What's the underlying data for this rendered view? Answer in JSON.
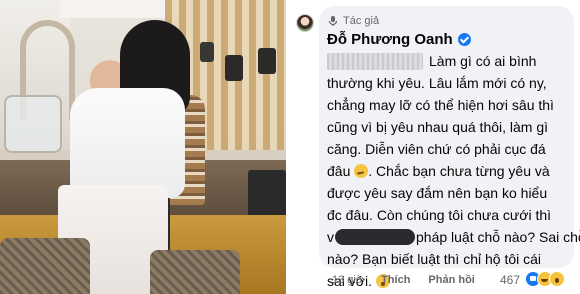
{
  "post": {
    "author_badge": "Tác giả",
    "author_name": "Đỗ Phương Oanh",
    "verified_icon": "verified-badge-icon",
    "comment_lines": [
      "Làm gì có ai bình",
      "thường khi yêu. Lâu lắm mới có ny,",
      "chẳng may lỡ có thể hiện hơi sâu thì",
      "cũng vì bị yêu nhau quá thôi, làm gì",
      "căng. Diễn viên chứ có phải cục đá",
      "đâu",
      ". Chắc bạn chưa từng yêu và",
      "được yêu say đắm nên bạn ko hiểu",
      "đc đâu. Còn chúng tôi chưa cưới thì",
      "pháp luật chỗ nào? Sai chỗ",
      "nào? Bạn biết luật thì chỉ hộ tôi cái",
      "sai với."
    ],
    "line_prefix_v": "v",
    "emoji_1": "smirk-emoji",
    "emoji_2": "shushing-emoji"
  },
  "footer": {
    "time": "13 giờ",
    "like_label": "Thích",
    "reply_label": "Phản hồi",
    "reaction_count": "467",
    "reactions": [
      "like-reaction-icon",
      "haha-reaction-icon",
      "wow-reaction-icon"
    ]
  },
  "colors": {
    "bubble_bg": "#f0f2f5",
    "text": "#050505",
    "meta": "#65676b",
    "accent": "#1877f2"
  }
}
